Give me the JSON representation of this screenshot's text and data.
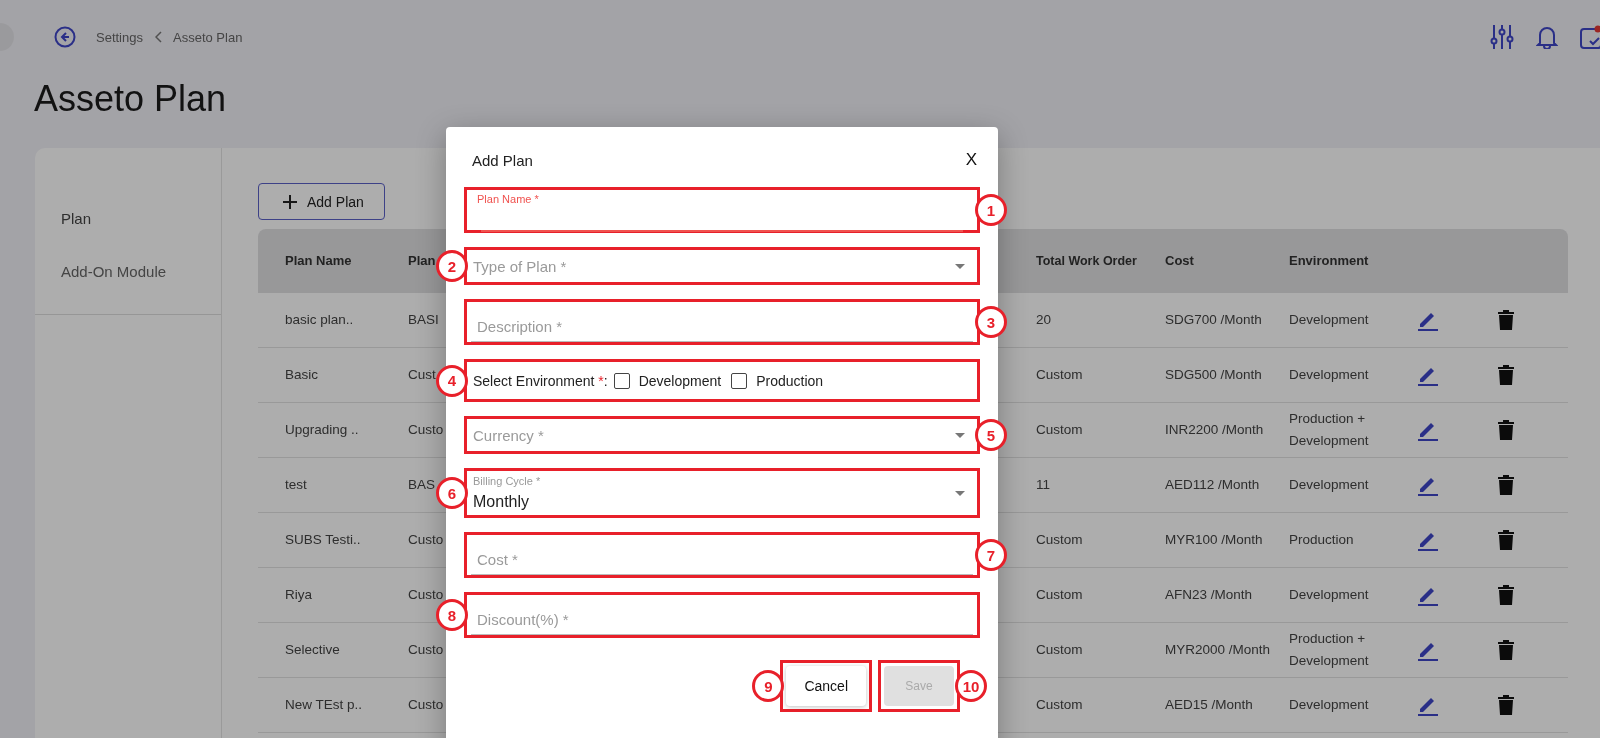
{
  "breadcrumb": [
    "Settings",
    "Asseto Plan"
  ],
  "page_title": "Asseto Plan",
  "sidebar": {
    "items": [
      {
        "label": "Plan",
        "selected": true
      },
      {
        "label": "Add-On Module",
        "selected": false
      }
    ]
  },
  "add_button": "Add Plan",
  "table": {
    "columns": [
      "Plan Name",
      "Plan",
      "Total Work Order",
      "Cost",
      "Environment"
    ],
    "rows": [
      {
        "cells": [
          "basic plan..",
          "BASI",
          "20",
          "SDG700 /Month",
          "Development"
        ]
      },
      {
        "cells": [
          "Basic",
          "Cust",
          "Custom",
          "SDG500 /Month",
          "Development"
        ]
      },
      {
        "cells": [
          "Upgrading ..",
          "Custo",
          "Custom",
          "INR2200 /Month",
          "Production + Development"
        ]
      },
      {
        "cells": [
          "test",
          "BAS",
          "11",
          "AED112 /Month",
          "Development"
        ]
      },
      {
        "cells": [
          "SUBS Testi..",
          "Custo",
          "Custom",
          "MYR100 /Month",
          "Production"
        ]
      },
      {
        "cells": [
          "Riya",
          "Custo",
          "Custom",
          "AFN23 /Month",
          "Development"
        ]
      },
      {
        "cells": [
          "Selective",
          "Custo",
          "Custom",
          "MYR2000 /Month",
          "Production + Development"
        ]
      },
      {
        "cells": [
          "New TEst p..",
          "Custo",
          "Custom",
          "AED15 /Month",
          "Development"
        ]
      }
    ]
  },
  "dialog": {
    "title": "Add Plan",
    "close": "X",
    "fields": [
      {
        "kind": "text",
        "label": "Plan Name *",
        "focused": true,
        "callout": "1"
      },
      {
        "kind": "select",
        "label": "Type of Plan *",
        "callout": "2"
      },
      {
        "kind": "text",
        "label": "Description *",
        "focused": false,
        "callout": "3"
      },
      {
        "kind": "checkboxes",
        "label": "Select Environment ",
        "required": "*",
        "suffix": ":",
        "options": [
          {
            "label": "Development",
            "checked": false
          },
          {
            "label": "Production",
            "checked": false
          }
        ],
        "callout": "4"
      },
      {
        "kind": "select",
        "label": "Currency *",
        "callout": "5"
      },
      {
        "kind": "select",
        "label": "Billing Cycle *",
        "value": "Monthly",
        "callout": "6"
      },
      {
        "kind": "text",
        "label": "Cost *",
        "focused": false,
        "callout": "7"
      },
      {
        "kind": "text",
        "label": "Discount(%) *",
        "focused": false,
        "callout": "8"
      }
    ],
    "buttons": [
      {
        "label": "Cancel",
        "disabled": false,
        "callout": "9"
      },
      {
        "label": "Save",
        "disabled": true,
        "callout": "10"
      }
    ]
  }
}
